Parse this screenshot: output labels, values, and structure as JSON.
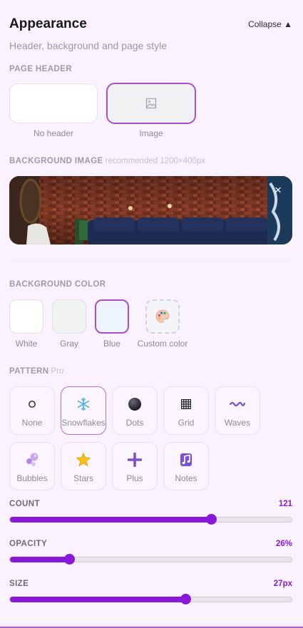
{
  "header": {
    "title": "Appearance",
    "collapse_label": "Collapse ▲",
    "subtitle": "Header, background and page style"
  },
  "page_header": {
    "label": "PAGE HEADER",
    "options": [
      {
        "label": "No header",
        "selected": false
      },
      {
        "label": "Image",
        "selected": true,
        "icon": "image-icon"
      }
    ]
  },
  "background_image": {
    "label": "BACKGROUND IMAGE",
    "hint": "recommended 1200×400px",
    "close_glyph": "×"
  },
  "background_color": {
    "label": "BACKGROUND COLOR",
    "options": [
      {
        "label": "White",
        "color": "#ffffff",
        "selected": false
      },
      {
        "label": "Gray",
        "color": "#f1f2f4",
        "selected": false
      },
      {
        "label": "Blue",
        "color": "#eef4ff",
        "selected": true
      },
      {
        "label": "Custom color",
        "icon": "palette-icon",
        "selected": false
      }
    ]
  },
  "pattern": {
    "label": "PATTERN",
    "badge": "Pro",
    "options": [
      {
        "label": "None",
        "icon": "circle-outline-icon",
        "selected": false
      },
      {
        "label": "Snowflakes",
        "icon": "snowflake-icon",
        "selected": true
      },
      {
        "label": "Dots",
        "icon": "dot-icon",
        "selected": false
      },
      {
        "label": "Grid",
        "icon": "grid-icon",
        "selected": false
      },
      {
        "label": "Waves",
        "icon": "wave-icon",
        "selected": false
      },
      {
        "label": "Bubbles",
        "icon": "bubbles-icon",
        "selected": false
      },
      {
        "label": "Stars",
        "icon": "star-icon",
        "selected": false
      },
      {
        "label": "Plus",
        "icon": "plus-icon",
        "selected": false
      },
      {
        "label": "Notes",
        "icon": "music-note-icon",
        "selected": false
      }
    ]
  },
  "sliders": [
    {
      "label": "COUNT",
      "value_text": "121",
      "fraction": 0.71
    },
    {
      "label": "OPACITY",
      "value_text": "26%",
      "fraction": 0.21
    },
    {
      "label": "SIZE",
      "value_text": "27px",
      "fraction": 0.62
    }
  ],
  "colors": {
    "accent": "#8a18d8",
    "selected_border": "#a64ed6",
    "background": "#faf3ff"
  }
}
